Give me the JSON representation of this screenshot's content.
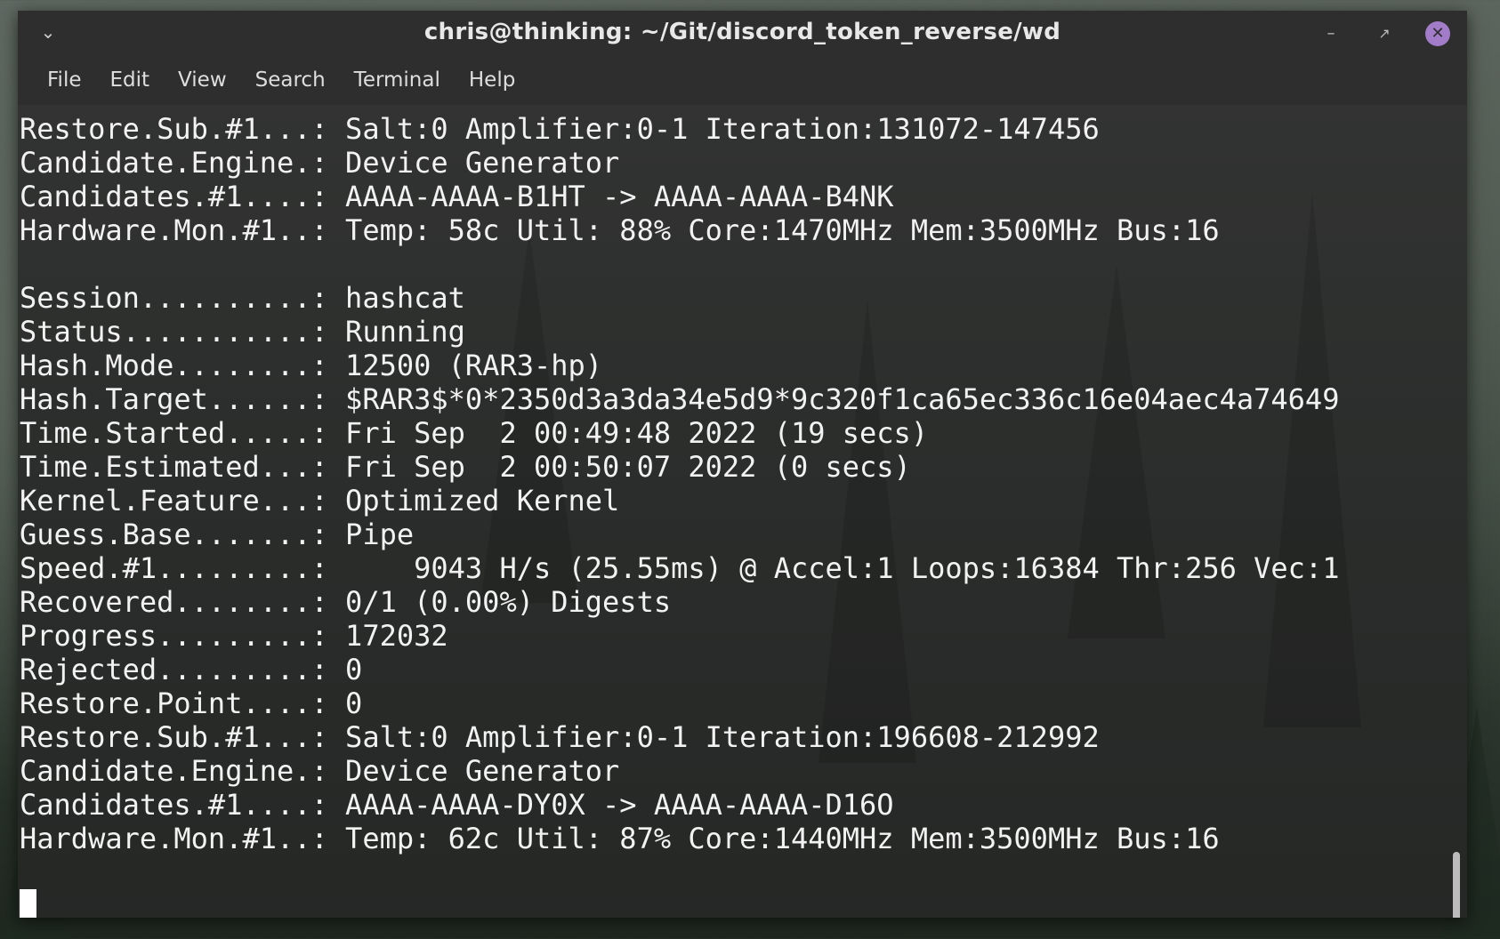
{
  "window": {
    "title": "chris@thinking: ~/Git/discord_token_reverse/wd",
    "menu_icon": "chevron-down-icon",
    "minimize_icon": "minimize-icon",
    "maximize_icon": "maximize-icon",
    "close_icon": "close-icon",
    "close_color": "#a37cc9"
  },
  "menubar": {
    "items": [
      "File",
      "Edit",
      "View",
      "Search",
      "Terminal",
      "Help"
    ]
  },
  "terminal": {
    "lines": [
      "Restore.Sub.#1...: Salt:0 Amplifier:0-1 Iteration:131072-147456",
      "Candidate.Engine.: Device Generator",
      "Candidates.#1....: AAAA-AAAA-B1HT -> AAAA-AAAA-B4NK",
      "Hardware.Mon.#1..: Temp: 58c Util: 88% Core:1470MHz Mem:3500MHz Bus:16",
      "",
      "Session..........: hashcat",
      "Status...........: Running",
      "Hash.Mode........: 12500 (RAR3-hp)",
      "Hash.Target......: $RAR3$*0*2350d3a3da34e5d9*9c320f1ca65ec336c16e04aec4a74649",
      "Time.Started.....: Fri Sep  2 00:49:48 2022 (19 secs)",
      "Time.Estimated...: Fri Sep  2 00:50:07 2022 (0 secs)",
      "Kernel.Feature...: Optimized Kernel",
      "Guess.Base.......: Pipe",
      "Speed.#1.........:     9043 H/s (25.55ms) @ Accel:1 Loops:16384 Thr:256 Vec:1",
      "Recovered........: 0/1 (0.00%) Digests",
      "Progress.........: 172032",
      "Rejected.........: 0",
      "Restore.Point....: 0",
      "Restore.Sub.#1...: Salt:0 Amplifier:0-1 Iteration:196608-212992",
      "Candidate.Engine.: Device Generator",
      "Candidates.#1....: AAAA-AAAA-DY0X -> AAAA-AAAA-D16O",
      "Hardware.Mon.#1..: Temp: 62c Util: 87% Core:1440MHz Mem:3500MHz Bus:16"
    ]
  }
}
